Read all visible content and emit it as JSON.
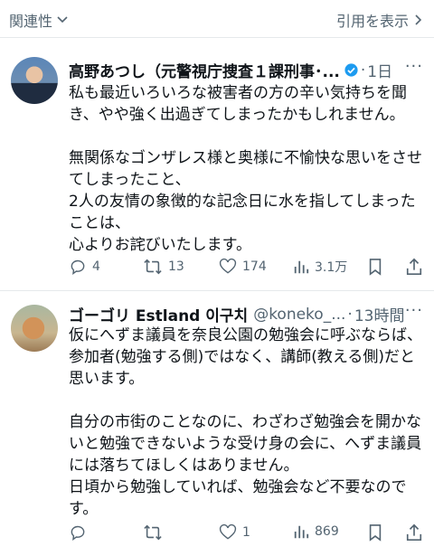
{
  "topbar": {
    "related_label": "関連性",
    "quote_label": "引用を表示"
  },
  "tweets": [
    {
      "name": "高野あつし（元警視庁捜査１課刑事･...",
      "handle": "",
      "separator": "·",
      "time": "1日",
      "verified": true,
      "body": [
        "私も最近いろいろな被害者の方の辛い気持ちを聞き、やや強く出過ぎてしまったかもしれません。",
        "",
        "無関係なゴンザレス様と奥様に不愉快な思いをさせてしまったこと、",
        "2人の友情の象徴的な記念日に水を指してしまったことは、",
        "心よりお詫びいたします。"
      ],
      "actions": {
        "replies": "4",
        "retweets": "13",
        "likes": "174",
        "views": "3.1万"
      }
    },
    {
      "name": "ゴーゴリ Estland 이구치",
      "handle": "@koneko_...",
      "separator": "·",
      "time": "13時間",
      "verified": false,
      "body": [
        "仮にへずま議員を奈良公園の勉強会に呼ぶならば、参加者(勉強する側)ではなく、講師(教える側)だと思います。",
        "",
        "自分の市街のことなのに、わざわざ勉強会を開かないと勉強できないような受け身の会に、へずま議員には落ちてほしくはありません。",
        "日頃から勉強していれば、勉強会など不要なのです。"
      ],
      "actions": {
        "replies": "",
        "retweets": "",
        "likes": "1",
        "views": "869"
      }
    }
  ],
  "colors": {
    "text": "#0f1419",
    "secondary": "#536471",
    "verified": "#1d9bf0",
    "divider": "#e6e9eb"
  },
  "icons": [
    "chevron-down-icon",
    "chevron-right-icon",
    "verified-badge-icon",
    "more-icon",
    "reply-icon",
    "retweet-icon",
    "like-icon",
    "views-icon",
    "bookmark-icon",
    "share-icon"
  ]
}
